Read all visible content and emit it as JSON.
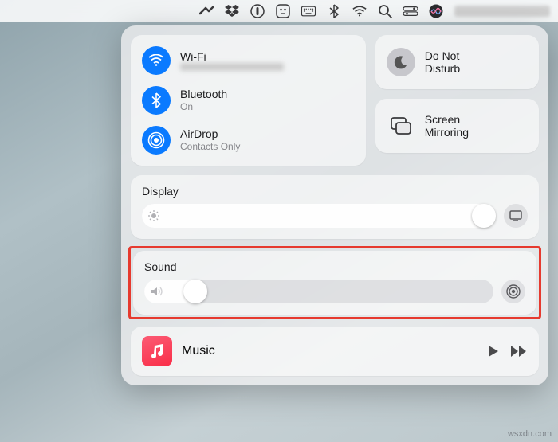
{
  "menubar": {
    "icons": [
      "wavy-icon",
      "dropbox-icon",
      "onepassword-icon",
      "app-icon",
      "keyboard-icon",
      "bluetooth-icon",
      "wifi-icon",
      "search-icon",
      "control-center-icon",
      "siri-icon"
    ]
  },
  "connectivity": {
    "wifi": {
      "label": "Wi-Fi",
      "status": ""
    },
    "bluetooth": {
      "label": "Bluetooth",
      "status": "On"
    },
    "airdrop": {
      "label": "AirDrop",
      "status": "Contacts Only"
    }
  },
  "dnd": {
    "label": "Do Not\nDisturb"
  },
  "screen_mirroring": {
    "label": "Screen\nMirroring"
  },
  "display": {
    "label": "Display",
    "value_pct": 100
  },
  "sound": {
    "label": "Sound",
    "value_pct": 18
  },
  "music": {
    "label": "Music"
  },
  "watermark": "wsxdn.com"
}
